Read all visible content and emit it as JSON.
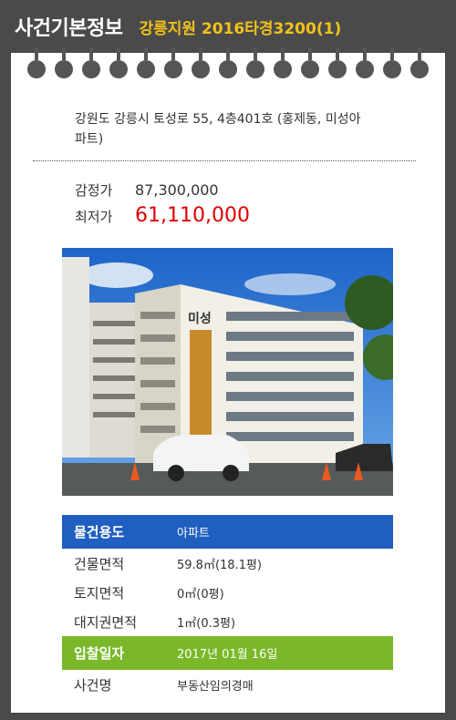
{
  "header": {
    "title": "사건기본정보",
    "case_label": "강릉지원 2016타경3200(1)"
  },
  "property": {
    "address": "강원도 강릉시 토성로 55, 4층401호 (홍제동, 미성아파트)"
  },
  "price": {
    "appraisal_label": "감정가",
    "appraisal_value": "87,300,000",
    "minimum_label": "최저가",
    "minimum_value": "61,110,000"
  },
  "photo": {
    "building_sign": "미성"
  },
  "details": [
    {
      "label": "물건용도",
      "value": "아파트",
      "style": "blue"
    },
    {
      "label": "건물면적",
      "value": "59.8㎡(18.1평)",
      "style": "plain"
    },
    {
      "label": "토지면적",
      "value": "0㎡(0평)",
      "style": "plain"
    },
    {
      "label": "대지권면적",
      "value": "1㎡(0.3평)",
      "style": "plain"
    },
    {
      "label": "입찰일자",
      "value": "2017년 01월 16일",
      "style": "green"
    },
    {
      "label": "사건명",
      "value": "부동산임의경매",
      "style": "plain"
    }
  ],
  "colors": {
    "background": "#4a4a4a",
    "accent_yellow": "#f2c21a",
    "min_price_red": "#e00000",
    "row_blue": "#1f5fbf",
    "row_green": "#7ab829"
  }
}
